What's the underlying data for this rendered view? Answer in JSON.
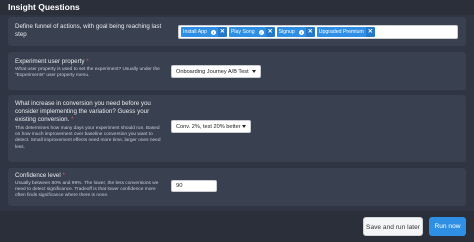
{
  "header": {
    "title": "Insight Questions"
  },
  "funnel": {
    "label": "Define funnel of actions, with goal being reaching last step",
    "required_mark": "*",
    "tags": [
      {
        "label": "Install App"
      },
      {
        "label": "Play Song"
      },
      {
        "label": "Signup"
      },
      {
        "label": "Upgraded Premium"
      }
    ],
    "remove_glyph": "✕",
    "info_glyph": "i"
  },
  "user_property": {
    "label": "Experiment user property",
    "required_mark": "*",
    "description": "What user property is used to set the experiment? Usually under the \"Experiments\" user property menu.",
    "selected": "Onboarding Journey A/B Test"
  },
  "conversion": {
    "label": "What increase in conversion you need before you consider implementing the variation? Guess your existing conversion.",
    "required_mark": "*",
    "description": "This determines how many days your experiment should run. Based on how much improvement over baseline conversion you want to detect. Small improvement effects need more time, larger ones need less.",
    "selected": "Conv. 2%, test 20% better"
  },
  "confidence": {
    "label": "Confidence level",
    "required_mark": "*",
    "description": "Usually between 80% and 99%. The lower, the less conversions we need to detect significance. Tradeoff is that lower confidence more often finds significance where there is none.",
    "value": "90"
  },
  "footer": {
    "save_label": "Save and run later",
    "run_label": "Run now"
  }
}
